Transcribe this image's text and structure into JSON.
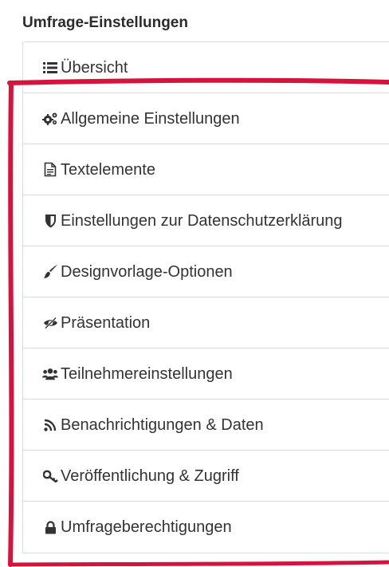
{
  "panel": {
    "title": "Umfrage-Einstellungen",
    "items": [
      {
        "label": "Übersicht",
        "icon": "list-icon"
      },
      {
        "label": "Allgemeine Einstellungen",
        "icon": "gears-icon"
      },
      {
        "label": "Textelemente",
        "icon": "document-icon"
      },
      {
        "label": "Einstellungen zur Datenschutzerklärung",
        "icon": "shield-icon"
      },
      {
        "label": "Designvorlage-Optionen",
        "icon": "paintbrush-icon"
      },
      {
        "label": "Präsentation",
        "icon": "eye-slash-icon"
      },
      {
        "label": "Teilnehmereinstellungen",
        "icon": "users-icon"
      },
      {
        "label": "Benachrichtigungen & Daten",
        "icon": "rss-icon"
      },
      {
        "label": "Veröffentlichung & Zugriff",
        "icon": "key-icon"
      },
      {
        "label": "Umfrageberechtigungen",
        "icon": "lock-icon"
      }
    ]
  },
  "annotation": {
    "color": "#d4143c"
  }
}
